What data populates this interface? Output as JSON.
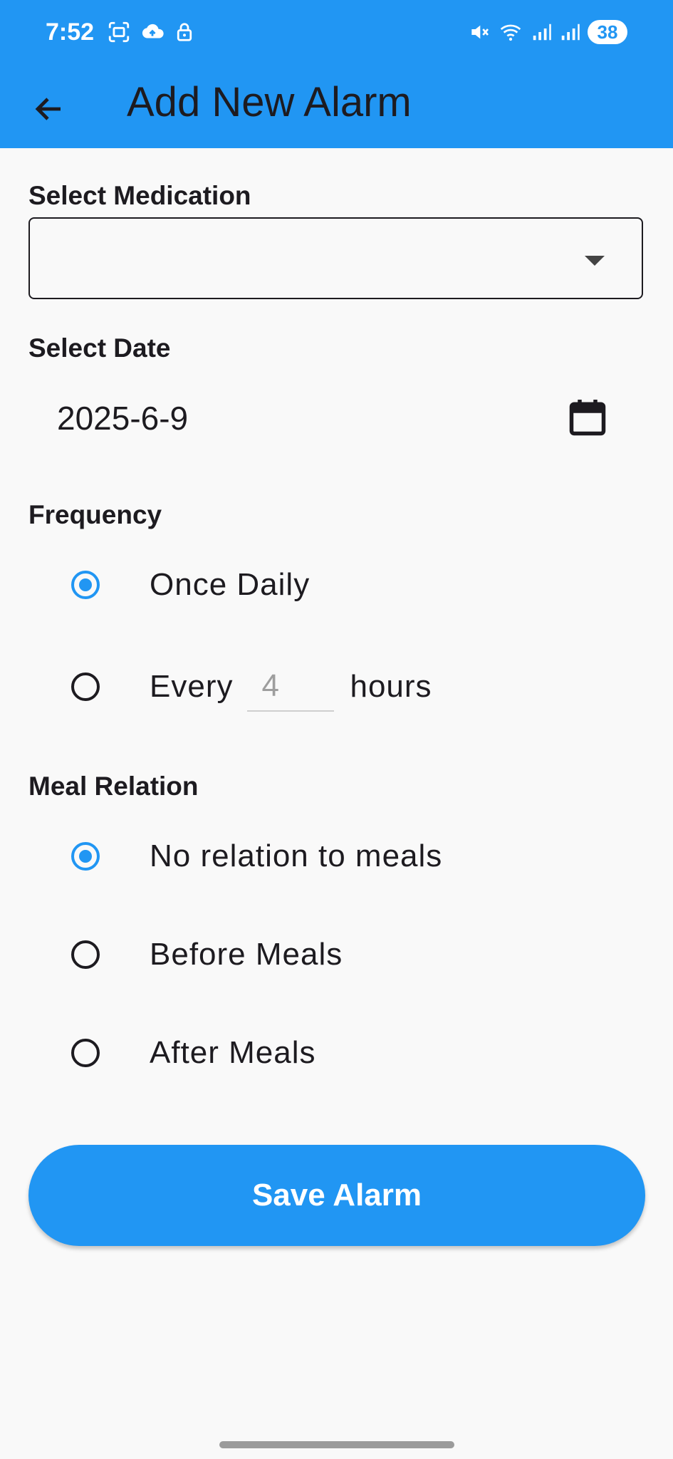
{
  "status_bar": {
    "time": "7:52",
    "battery": "38",
    "icons_left": [
      "screenshot-icon",
      "cloud-upload-icon",
      "lock-icon"
    ],
    "icons_right": [
      "mute-icon",
      "wifi-icon",
      "signal-icon",
      "signal-icon"
    ]
  },
  "app_bar": {
    "title": "Add New Alarm",
    "back_icon": "arrow-back-icon",
    "background_color": "#2196f3"
  },
  "medication": {
    "label": "Select Medication",
    "value": ""
  },
  "date": {
    "label": "Select Date",
    "value": "2025-6-9",
    "icon": "calendar-icon"
  },
  "frequency": {
    "label": "Frequency",
    "options": [
      {
        "label": "Once Daily",
        "selected": true
      },
      {
        "prefix": "Every",
        "hours_placeholder": "4",
        "hours_value": "",
        "suffix": "hours",
        "selected": false
      }
    ]
  },
  "meal_relation": {
    "label": "Meal Relation",
    "options": [
      {
        "label": "No relation to meals",
        "selected": true
      },
      {
        "label": "Before Meals",
        "selected": false
      },
      {
        "label": "After Meals",
        "selected": false
      }
    ]
  },
  "save_button": {
    "label": "Save Alarm"
  },
  "colors": {
    "accent": "#2196f3",
    "background": "#f9f9f9",
    "text": "#1d1b20"
  }
}
